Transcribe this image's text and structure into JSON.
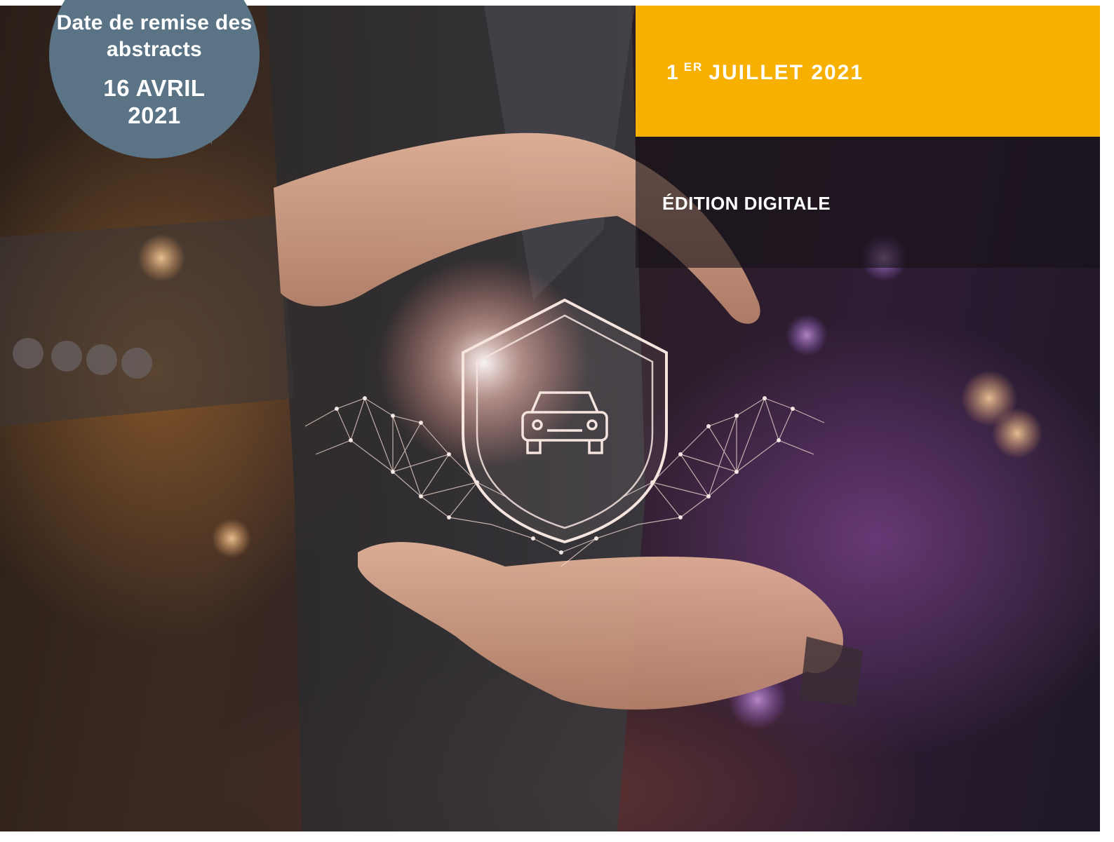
{
  "deadline": {
    "label": "Date de remise des abstracts",
    "date_line1": "16 AVRIL",
    "date_line2": "2021"
  },
  "event": {
    "date_main": "1",
    "date_suffix": "ER",
    "date_rest": "JUILLET 2021",
    "edition": "ÉDITION DIGITALE"
  },
  "photo": {
    "subject": "hands-protecting-car-shield-icon"
  },
  "colors": {
    "bubble": "#5a7486",
    "date_panel": "#f7b000",
    "edition_panel": "#161216",
    "text": "#ffffff",
    "glow": "#ffd9cf"
  }
}
